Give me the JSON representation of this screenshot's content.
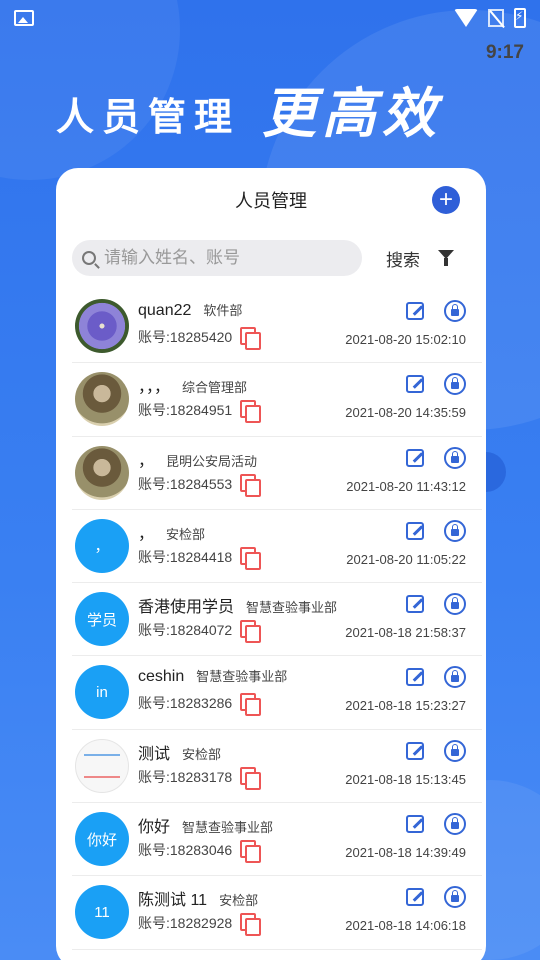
{
  "status_bar": {
    "time": "9:17"
  },
  "hero": {
    "title_left": "人员管理",
    "title_right": "更高效"
  },
  "card": {
    "title": "人员管理"
  },
  "search": {
    "placeholder": "请输入姓名、账号",
    "button_label": "搜索"
  },
  "people": [
    {
      "name": "quan22",
      "dept": "软件部",
      "account": "账号:18285420",
      "time": "2021-08-20 15:02:10",
      "avatar_type": "flower",
      "avatar_text": ""
    },
    {
      "name": "，，，",
      "dept": "综合管理部",
      "account": "账号:18284951",
      "time": "2021-08-20 14:35:59",
      "avatar_type": "photo",
      "avatar_text": ""
    },
    {
      "name": "，",
      "dept": "昆明公安局活动",
      "account": "账号:18284553",
      "time": "2021-08-20 11:43:12",
      "avatar_type": "photo",
      "avatar_text": ""
    },
    {
      "name": "，",
      "dept": "安检部",
      "account": "账号:18284418",
      "time": "2021-08-20 11:05:22",
      "avatar_type": "blue",
      "avatar_text": "，"
    },
    {
      "name": "香港使用学员",
      "dept": "智慧查验事业部",
      "account": "账号:18284072",
      "time": "2021-08-18 21:58:37",
      "avatar_type": "blue",
      "avatar_text": "学员"
    },
    {
      "name": "ceshin",
      "dept": "智慧查验事业部",
      "account": "账号:18283286",
      "time": "2021-08-18 15:23:27",
      "avatar_type": "blue",
      "avatar_text": "in"
    },
    {
      "name": "测试",
      "dept": "安检部",
      "account": "账号:18283178",
      "time": "2021-08-18 15:13:45",
      "avatar_type": "doc",
      "avatar_text": ""
    },
    {
      "name": "你好",
      "dept": "智慧查验事业部",
      "account": "账号:18283046",
      "time": "2021-08-18 14:39:49",
      "avatar_type": "blue",
      "avatar_text": "你好"
    },
    {
      "name": "陈测试 11",
      "dept": "安检部",
      "account": "账号:18282928",
      "time": "2021-08-18 14:06:18",
      "avatar_type": "blue",
      "avatar_text": "11"
    }
  ]
}
